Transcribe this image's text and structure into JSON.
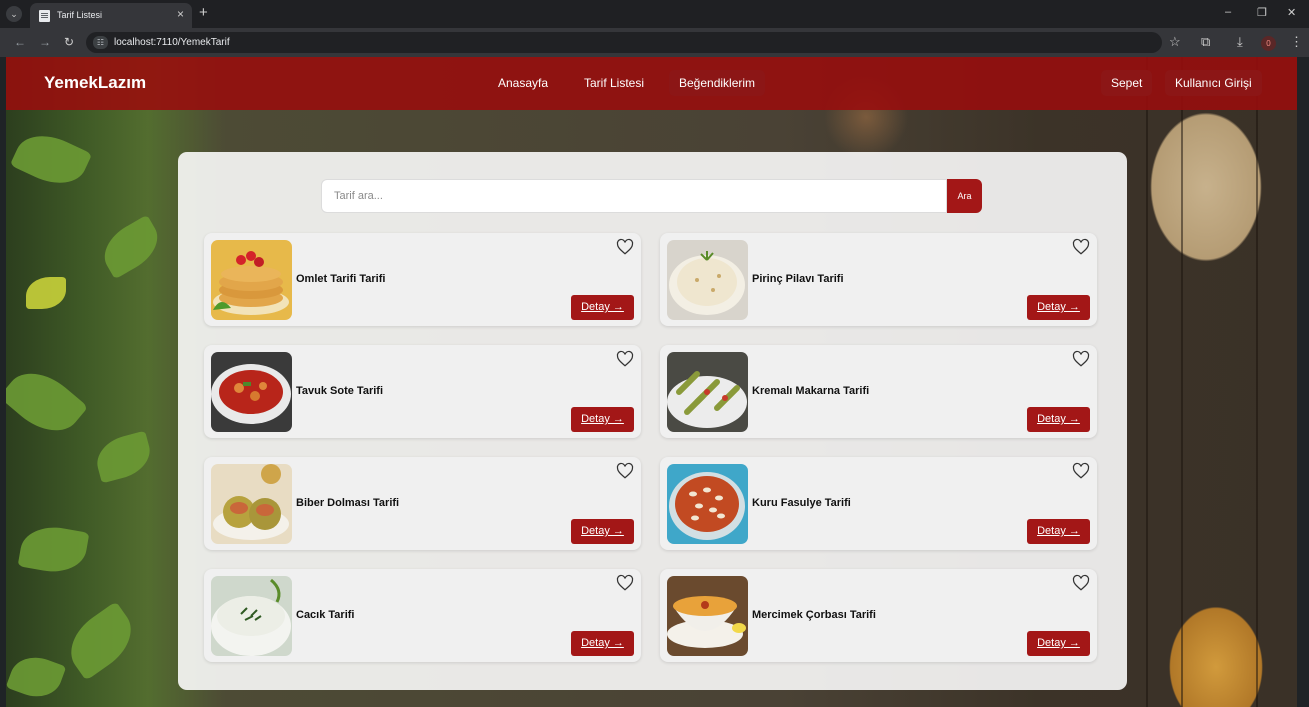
{
  "browser": {
    "tab_title": "Tarif Listesi",
    "url": "localhost:7110/YemekTarif",
    "notification_count": "0"
  },
  "navbar": {
    "brand": "YemekLazım",
    "links": [
      "Anasayfa",
      "Tarif Listesi",
      "Beğendiklerim"
    ],
    "cart": "Sepet",
    "login": "Kullanıcı Girişi"
  },
  "search": {
    "placeholder": "Tarif ara...",
    "button": "Ara"
  },
  "recipes": [
    {
      "title": "Omlet Tarifi Tarifi",
      "detail": "Detay →",
      "image": "pancake-stack"
    },
    {
      "title": "Pirinç Pilavı Tarifi",
      "detail": "Detay →",
      "image": "rice-pilaf"
    },
    {
      "title": "Tavuk Sote Tarifi",
      "detail": "Detay →",
      "image": "chicken-saute"
    },
    {
      "title": "Kremalı Makarna Tarifi",
      "detail": "Detay →",
      "image": "creamy-pasta"
    },
    {
      "title": "Biber Dolması Tarifi",
      "detail": "Detay →",
      "image": "stuffed-peppers"
    },
    {
      "title": "Kuru Fasulye Tarifi",
      "detail": "Detay →",
      "image": "bean-stew"
    },
    {
      "title": "Cacık Tarifi",
      "detail": "Detay →",
      "image": "cacik-bowl"
    },
    {
      "title": "Mercimek Çorbası Tarifi",
      "detail": "Detay →",
      "image": "lentil-soup"
    }
  ],
  "colors": {
    "brand_red": "#a31717",
    "navbar_red": "#980c0c",
    "card_bg": "#f0f0f0"
  }
}
